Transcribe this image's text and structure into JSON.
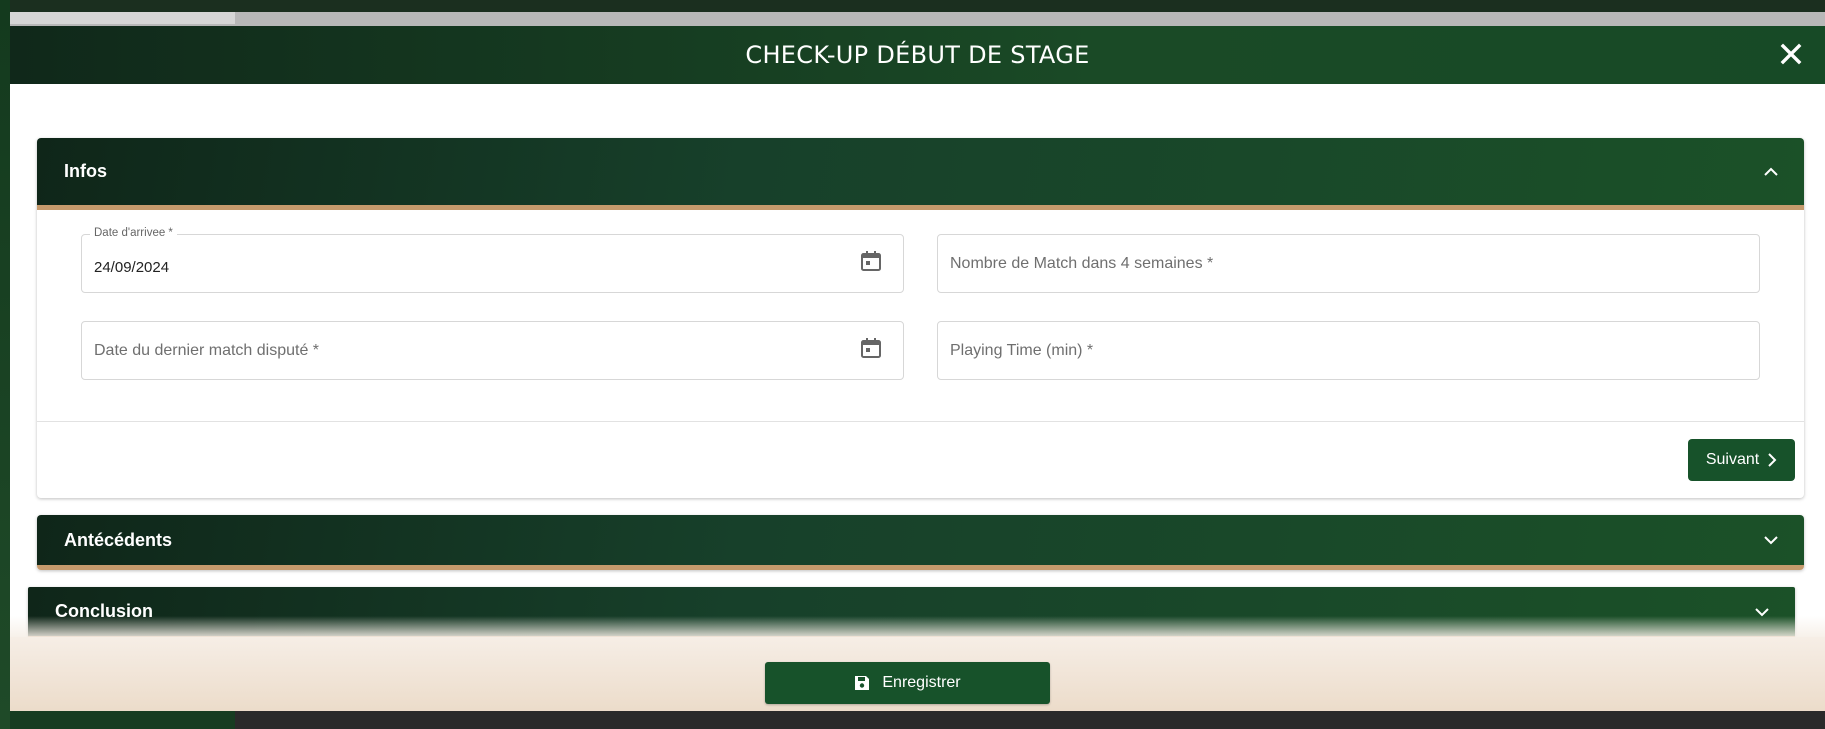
{
  "modal": {
    "title": "CHECK-UP DÉBUT DE STAGE",
    "close_icon": "close-icon"
  },
  "panels": {
    "infos": {
      "title": "Infos",
      "expanded": true,
      "fields": {
        "date_arrivee": {
          "label": "Date d'arrivee *",
          "value": "24/09/2024",
          "icon": "calendar-icon"
        },
        "nombre_match": {
          "placeholder": "Nombre de Match dans 4 semaines *"
        },
        "date_dernier_match": {
          "placeholder": "Date du dernier match disputé *",
          "icon": "calendar-icon"
        },
        "playing_time": {
          "placeholder": "Playing Time (min) *"
        }
      },
      "next_label": "Suivant"
    },
    "antecedents": {
      "title": "Antécédents",
      "expanded": false
    },
    "conclusion": {
      "title": "Conclusion",
      "expanded": false
    }
  },
  "footer": {
    "save_label": "Enregistrer",
    "save_icon": "save-icon"
  },
  "colors": {
    "header_dark": "#10281a",
    "header_green": "#1a4a26",
    "accent_tan": "#c59a6c",
    "button_green": "#17522a"
  }
}
